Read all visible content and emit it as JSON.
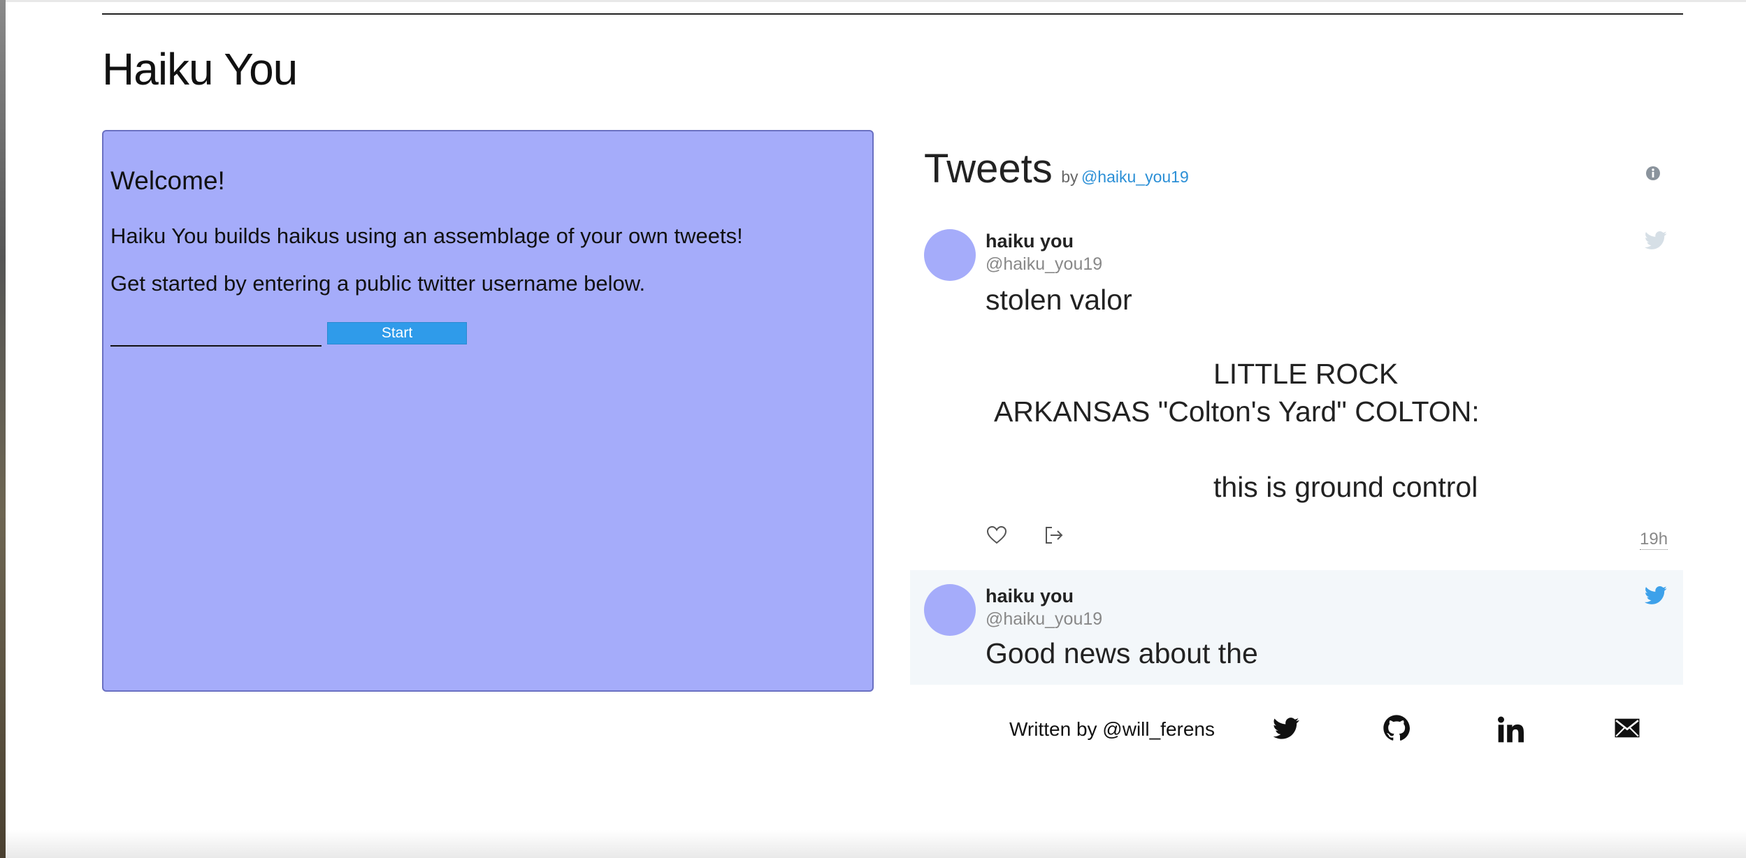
{
  "site": {
    "title": "Haiku You"
  },
  "welcome": {
    "heading": "Welcome!",
    "line1": "Haiku You builds haikus using an assemblage of your own tweets!",
    "line2": "Get started by entering a public twitter username below.",
    "input_value": "",
    "input_placeholder": "",
    "start_label": "Start"
  },
  "tweets": {
    "title": "Tweets",
    "by": "by",
    "handle": "@haiku_you19",
    "items": [
      {
        "name": "haiku you",
        "handle": "@haiku_you19",
        "line1": "stolen valor",
        "line2": "LITTLE ROCK",
        "line3": "ARKANSAS \"Colton's Yard\" COLTON:",
        "line4": "this is ground control",
        "time": "19h"
      },
      {
        "name": "haiku you",
        "handle": "@haiku_you19",
        "line1": "Good news about the"
      }
    ]
  },
  "footer": {
    "written_by": "Written by @will_ferens"
  },
  "icons": {
    "info": "info-icon",
    "bird": "twitter-bird-icon",
    "heart": "heart-icon",
    "share": "share-icon",
    "twitter": "twitter-icon",
    "github": "github-icon",
    "linkedin": "linkedin-icon",
    "mail": "mail-icon"
  },
  "colors": {
    "panel": "#a5acfa",
    "accent": "#2f9bea",
    "link": "#2b8fd6",
    "tweet_highlight": "#f3f7fa"
  }
}
